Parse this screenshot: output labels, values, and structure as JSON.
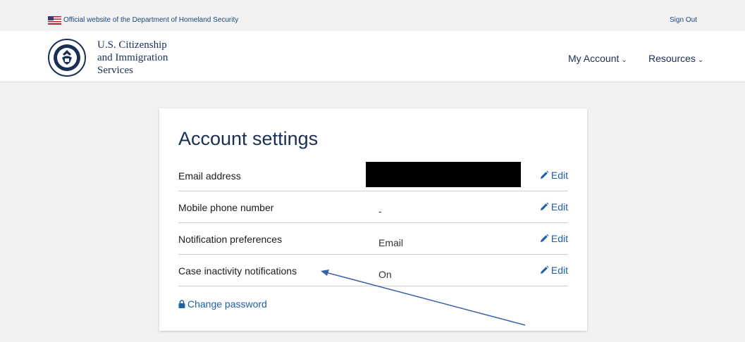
{
  "banner": {
    "official_text": "Official website of the Department of Homeland Security",
    "sign_out": "Sign Out"
  },
  "header": {
    "agency_line1": "U.S. Citizenship",
    "agency_line2": "and Immigration",
    "agency_line3": "Services",
    "nav": [
      {
        "label": "My Account"
      },
      {
        "label": "Resources"
      }
    ]
  },
  "settings": {
    "title": "Account settings",
    "edit_label": "Edit",
    "rows": [
      {
        "label": "Email address",
        "value": ""
      },
      {
        "label": "Mobile phone number",
        "value": "-"
      },
      {
        "label": "Notification preferences",
        "value": "Email"
      },
      {
        "label": "Case inactivity notifications",
        "value": "On"
      }
    ],
    "change_password": "Change password"
  },
  "colors": {
    "navy": "#1a2f56",
    "link": "#1f5fa8",
    "annotation": "#3a62a6"
  }
}
